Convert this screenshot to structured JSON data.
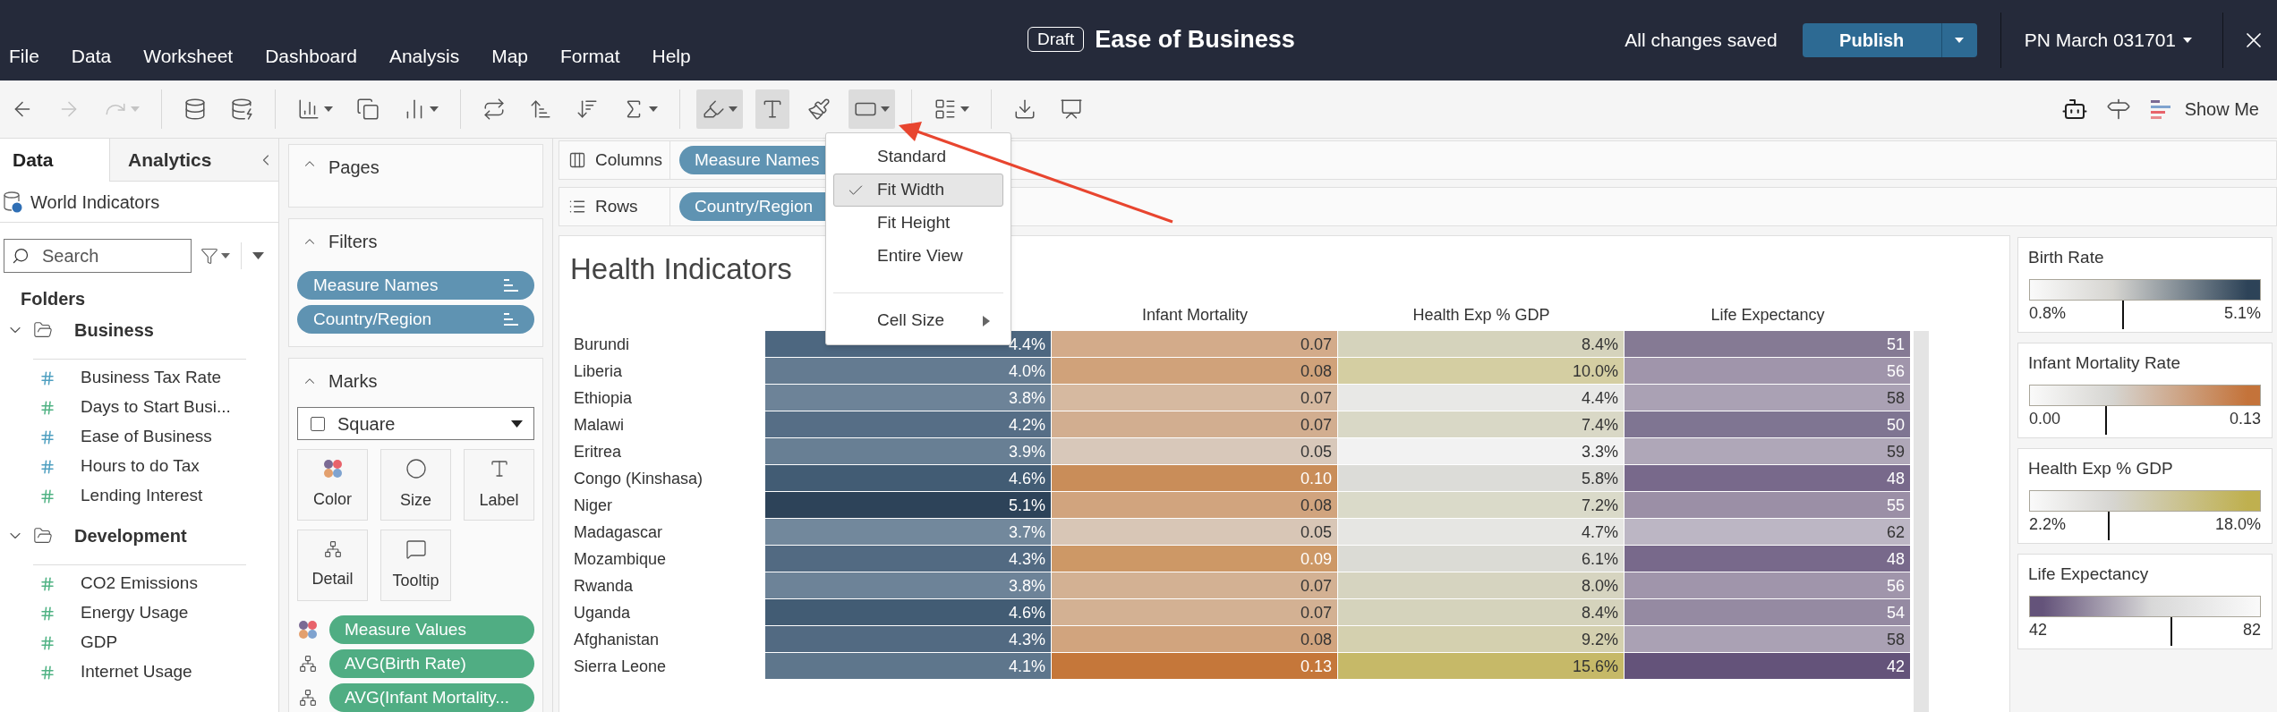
{
  "menu_bar": [
    "File",
    "Data",
    "Worksheet",
    "Dashboard",
    "Analysis",
    "Map",
    "Format",
    "Help"
  ],
  "title": {
    "badge": "Draft",
    "text": "Ease of Business"
  },
  "save_status": "All changes saved",
  "publish": "Publish",
  "user": "PN March 031701",
  "toolbar_groups": [
    [
      {
        "kind": "back",
        "disabled": false,
        "pressed": false,
        "dropdown": false
      },
      {
        "kind": "forward",
        "disabled": true,
        "pressed": false,
        "dropdown": false
      },
      {
        "kind": "redo",
        "disabled": true,
        "pressed": false,
        "dropdown": true
      }
    ],
    [
      {
        "kind": "new-data-source",
        "disabled": false,
        "pressed": false,
        "dropdown": false
      },
      {
        "kind": "pause-updates",
        "disabled": false,
        "pressed": false,
        "dropdown": false
      }
    ],
    [
      {
        "kind": "new-worksheet",
        "disabled": false,
        "pressed": false,
        "dropdown": true
      },
      {
        "kind": "duplicate",
        "disabled": false,
        "pressed": false,
        "dropdown": false
      },
      {
        "kind": "clear",
        "disabled": false,
        "pressed": false,
        "dropdown": true
      }
    ],
    [
      {
        "kind": "swap",
        "disabled": false,
        "pressed": false,
        "dropdown": false
      },
      {
        "kind": "sort-asc",
        "disabled": false,
        "pressed": false,
        "dropdown": false
      },
      {
        "kind": "sort-desc",
        "disabled": false,
        "pressed": false,
        "dropdown": false
      },
      {
        "kind": "totals",
        "disabled": false,
        "pressed": false,
        "dropdown": true
      }
    ],
    [
      {
        "kind": "highlight",
        "disabled": false,
        "pressed": true,
        "dropdown": true
      },
      {
        "kind": "labels",
        "disabled": false,
        "pressed": true,
        "dropdown": false
      },
      {
        "kind": "format",
        "disabled": false,
        "pressed": false,
        "dropdown": false
      },
      {
        "kind": "fit",
        "disabled": false,
        "pressed": true,
        "dropdown": true
      }
    ],
    [
      {
        "kind": "cards",
        "disabled": false,
        "pressed": false,
        "dropdown": true
      }
    ],
    [
      {
        "kind": "download",
        "disabled": false,
        "pressed": false,
        "dropdown": false
      },
      {
        "kind": "presentation",
        "disabled": false,
        "pressed": false,
        "dropdown": false
      }
    ]
  ],
  "show_me": "Show Me",
  "data_pane": {
    "tabs": [
      {
        "label": "Data",
        "selected": true
      },
      {
        "label": "Analytics",
        "selected": false
      }
    ],
    "source": "World Indicators",
    "search": {
      "placeholder": "Search"
    },
    "folders_label": "Folders",
    "folders": [
      {
        "name": "Business",
        "expanded": true,
        "children": [
          {
            "name": "Business Tax Rate",
            "color": "#4e9fc0"
          },
          {
            "name": "Days to Start Busi...",
            "color": "#4fb283"
          },
          {
            "name": "Ease of Business",
            "color": "#4e9fc0"
          },
          {
            "name": "Hours to do Tax",
            "color": "#4e9fc0"
          },
          {
            "name": "Lending Interest",
            "color": "#4fb283"
          }
        ]
      },
      {
        "name": "Development",
        "expanded": true,
        "children": [
          {
            "name": "CO2 Emissions",
            "color": "#4fb283"
          },
          {
            "name": "Energy Usage",
            "color": "#4fb283"
          },
          {
            "name": "GDP",
            "color": "#4fb283"
          },
          {
            "name": "Internet Usage",
            "color": "#4fb283"
          }
        ]
      }
    ]
  },
  "pages": {
    "title": "Pages"
  },
  "filters": {
    "title": "Filters",
    "pills": [
      "Measure Names",
      "Country/Region"
    ]
  },
  "marks": {
    "title": "Marks",
    "type": "Square",
    "buttons": [
      {
        "kind": "color",
        "label": "Color"
      },
      {
        "kind": "size",
        "label": "Size"
      },
      {
        "kind": "label",
        "label": "Label"
      },
      {
        "kind": "detail",
        "label": "Detail"
      },
      {
        "kind": "tooltip",
        "label": "Tooltip"
      }
    ],
    "fields": [
      {
        "kind": "color",
        "label": "Measure Values"
      },
      {
        "kind": "detail",
        "label": "AVG(Birth Rate)"
      },
      {
        "kind": "detail",
        "label": "AVG(Infant Mortality..."
      }
    ]
  },
  "shelves": [
    {
      "kind": "columns",
      "label": "Columns",
      "pill": "Measure Names"
    },
    {
      "kind": "rows",
      "label": "Rows",
      "pill": "Country/Region"
    }
  ],
  "view": {
    "title": "Health Indicators",
    "column_headings": [
      "Infant Mortality",
      "Health Exp % GDP",
      "Life Expectancy"
    ],
    "rows": [
      {
        "label": "Burundi",
        "cells": [
          {
            "value": "4.4%",
            "color": "#4d6780"
          },
          {
            "value": "0.07",
            "color": "#d3ab8a"
          },
          {
            "value": "8.4%",
            "color": "#d5d3bc"
          },
          {
            "value": "51",
            "color": "#857a94"
          }
        ]
      },
      {
        "label": "Liberia",
        "cells": [
          {
            "value": "4.0%",
            "color": "#647b91"
          },
          {
            "value": "0.08",
            "color": "#d0a27a"
          },
          {
            "value": "10.0%",
            "color": "#d4cea2"
          },
          {
            "value": "56",
            "color": "#a095ab"
          }
        ]
      },
      {
        "label": "Ethiopia",
        "cells": [
          {
            "value": "3.8%",
            "color": "#6d8398"
          },
          {
            "value": "0.07",
            "color": "#d6b9a0"
          },
          {
            "value": "4.4%",
            "color": "#e8e8e6"
          },
          {
            "value": "58",
            "color": "#aaa1b4"
          }
        ]
      },
      {
        "label": "Malawi",
        "cells": [
          {
            "value": "4.2%",
            "color": "#566e86"
          },
          {
            "value": "0.07",
            "color": "#d2ae90"
          },
          {
            "value": "7.4%",
            "color": "#d9d8c6"
          },
          {
            "value": "50",
            "color": "#7f7592"
          }
        ]
      },
      {
        "label": "Eritrea",
        "cells": [
          {
            "value": "3.9%",
            "color": "#687f94"
          },
          {
            "value": "0.05",
            "color": "#d8c8ba"
          },
          {
            "value": "3.3%",
            "color": "#f2f2f2"
          },
          {
            "value": "59",
            "color": "#afa7b8"
          }
        ]
      },
      {
        "label": "Congo (Kinshasa)",
        "cells": [
          {
            "value": "4.6%",
            "color": "#425c74"
          },
          {
            "value": "0.10",
            "color": "#c98d59"
          },
          {
            "value": "5.8%",
            "color": "#dcdcd8"
          },
          {
            "value": "48",
            "color": "#78698b"
          }
        ]
      },
      {
        "label": "Niger",
        "cells": [
          {
            "value": "5.1%",
            "color": "#2d4359"
          },
          {
            "value": "0.08",
            "color": "#d1a47e"
          },
          {
            "value": "7.2%",
            "color": "#dadac9"
          },
          {
            "value": "55",
            "color": "#9b8fa6"
          }
        ]
      },
      {
        "label": "Madagascar",
        "cells": [
          {
            "value": "3.7%",
            "color": "#72889c"
          },
          {
            "value": "0.05",
            "color": "#d8c6b6"
          },
          {
            "value": "4.7%",
            "color": "#e6e6e3"
          },
          {
            "value": "62",
            "color": "#bcb6c4"
          }
        ]
      },
      {
        "label": "Mozambique",
        "cells": [
          {
            "value": "4.3%",
            "color": "#526a82"
          },
          {
            "value": "0.09",
            "color": "#cd9866"
          },
          {
            "value": "6.1%",
            "color": "#dbdbd5"
          },
          {
            "value": "48",
            "color": "#78698b"
          }
        ]
      },
      {
        "label": "Rwanda",
        "cells": [
          {
            "value": "3.8%",
            "color": "#6d8398"
          },
          {
            "value": "0.07",
            "color": "#d3b193"
          },
          {
            "value": "8.0%",
            "color": "#d6d4c0"
          },
          {
            "value": "56",
            "color": "#a095ab"
          }
        ]
      },
      {
        "label": "Uganda",
        "cells": [
          {
            "value": "4.6%",
            "color": "#425c74"
          },
          {
            "value": "0.07",
            "color": "#d3b193"
          },
          {
            "value": "8.4%",
            "color": "#d5d3bc"
          },
          {
            "value": "54",
            "color": "#958aa2"
          }
        ]
      },
      {
        "label": "Afghanistan",
        "cells": [
          {
            "value": "4.3%",
            "color": "#526a82"
          },
          {
            "value": "0.08",
            "color": "#d1a47e"
          },
          {
            "value": "9.2%",
            "color": "#d4d0af"
          },
          {
            "value": "58",
            "color": "#aaa1b4"
          }
        ]
      },
      {
        "label": "Sierra Leone",
        "cells": [
          {
            "value": "4.1%",
            "color": "#5e768c"
          },
          {
            "value": "0.13",
            "color": "#c5773a"
          },
          {
            "value": "15.6%",
            "color": "#c6b968"
          },
          {
            "value": "42",
            "color": "#64537a"
          }
        ]
      }
    ]
  },
  "legends": [
    {
      "title": "Birth Rate",
      "min": "0.8%",
      "max": "5.1%",
      "color": "#2d4358",
      "reversed": false,
      "level": 0.4
    },
    {
      "title": "Infant Mortality Rate",
      "min": "0.00",
      "max": "0.13",
      "color": "#c4733a",
      "reversed": false,
      "level": 0.33
    },
    {
      "title": "Health Exp % GDP",
      "min": "2.2%",
      "max": "18.0%",
      "color": "#bfb04f",
      "reversed": false,
      "level": 0.34
    },
    {
      "title": "Life Expectancy",
      "min": "42",
      "max": "82",
      "color": "#64537a",
      "reversed": true,
      "level": 0.61
    }
  ],
  "fit_menu": {
    "items": [
      {
        "label": "Standard",
        "kind": "option",
        "checked": false,
        "selected": false
      },
      {
        "label": "Fit Width",
        "kind": "option",
        "checked": true,
        "selected": true
      },
      {
        "label": "Fit Height",
        "kind": "option",
        "checked": false,
        "selected": false
      },
      {
        "label": "Entire View",
        "kind": "option",
        "checked": false,
        "selected": false
      },
      {
        "label": "Cell Size",
        "kind": "submenu",
        "checked": false,
        "selected": false
      }
    ]
  }
}
